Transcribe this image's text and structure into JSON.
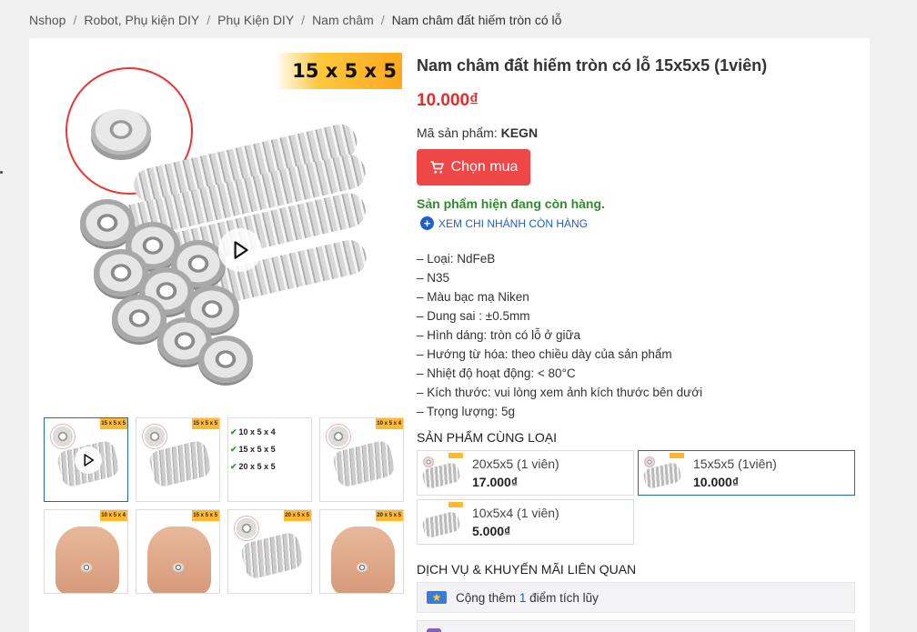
{
  "breadcrumb": {
    "items": [
      "Nshop",
      "Robot, Phụ kiện DIY",
      "Phụ Kiện DIY",
      "Nam châm"
    ],
    "current": "Nam châm đất hiếm tròn có lỗ",
    "separator": "/"
  },
  "gallery": {
    "main_badge": "15 x 5 x 5",
    "thumbs": [
      {
        "badge": "15 x 5 x 5",
        "kind": "video"
      },
      {
        "badge": "15 x 5 x 5",
        "kind": "stack"
      },
      {
        "badge": "",
        "kind": "sizes",
        "lines": [
          "10 x 5 x 4",
          "15 x 5 x 5",
          "20 x 5 x 5"
        ]
      },
      {
        "badge": "10 x 5 x 4",
        "kind": "stack"
      },
      {
        "badge": "10 x 5 x 4",
        "kind": "hand"
      },
      {
        "badge": "15 x 5 x 5",
        "kind": "hand"
      },
      {
        "badge": "20 x 5 x 5",
        "kind": "stack"
      },
      {
        "badge": "20 x 5 x 5",
        "kind": "hand"
      }
    ]
  },
  "product": {
    "title": "Nam châm đất hiếm tròn có lỗ 15x5x5 (1viên)",
    "price": "10.000₫",
    "sku_label": "Mã sản phẩm:",
    "sku": "KEGN",
    "buy_label": "Chọn mua",
    "stock_status": "Sản phẩm hiện đang còn hàng.",
    "branches_link": "XEM CHI NHÁNH CÒN HÀNG",
    "specs": [
      "– Loại: NdFeB",
      "– N35",
      "– Màu bạc mạ Niken",
      "– Dung sai : ±0.5mm",
      "– Hình dáng: tròn có lỗ ở giữa",
      "– Hướng từ hóa: theo chiều dày của sản phẩm",
      "– Nhiệt độ hoạt động: < 80°C",
      "– Kích thước: vui lòng xem ảnh kích thước bên dưới",
      "– Trọng lượng: 5g"
    ]
  },
  "related": {
    "title": "SẢN PHẨM CÙNG LOẠI",
    "items": [
      {
        "name": "20x5x5 (1 viên)",
        "price": "17.000₫"
      },
      {
        "name": "15x5x5 (1viên)",
        "price": "10.000₫"
      },
      {
        "name": "10x5x4 (1 viên)",
        "price": "5.000₫"
      }
    ]
  },
  "services": {
    "title": "DỊCH VỤ & KHUYẾN MÃI LIÊN QUAN",
    "promo_prefix": "Cộng thêm",
    "promo_num": "1",
    "promo_suffix": "điểm tích lũy"
  },
  "colors": {
    "price": "#e32c2c",
    "buy_button": "#ef4646",
    "stock": "#2e8b2e",
    "link": "#1f5fc8",
    "badge": "#ffb830"
  }
}
